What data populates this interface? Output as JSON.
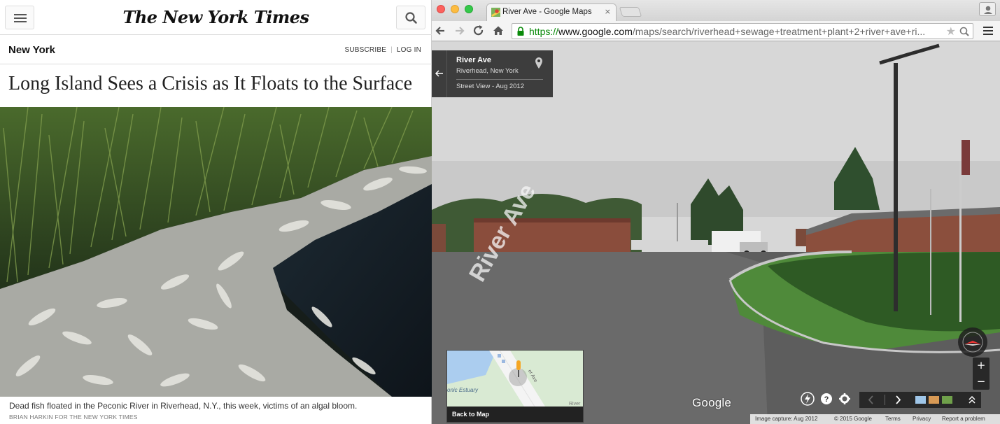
{
  "nyt": {
    "logo": "The New York Times",
    "section": "New York",
    "subscribe": "SUBSCRIBE",
    "login": "LOG IN",
    "headline": "Long Island Sees a Crisis as It Floats to the Surface",
    "caption": "Dead fish floated in the Peconic River in Riverhead, N.Y., this week, victims of an algal bloom.",
    "credit": "BRIAN HARKIN FOR THE NEW YORK TIMES",
    "icons": {
      "menu": "hamburger-icon",
      "search": "search-icon"
    }
  },
  "browser": {
    "tab_title": "River Ave - Google Maps",
    "tab_close": "×",
    "url_scheme": "https://",
    "url_host": "www.google.com",
    "url_path": "/maps/search/riverhead+sewage+treatment+plant+2+river+ave+ri...",
    "icons": {
      "back": "back-arrow-icon",
      "forward": "forward-arrow-icon",
      "reload": "reload-icon",
      "home": "home-icon",
      "lock": "lock-icon",
      "bookmark": "star-icon",
      "menu": "chrome-menu-icon"
    }
  },
  "streetview": {
    "place_title": "River Ave",
    "place_subtitle": "Riverhead, New York",
    "capture_label": "Street View - Aug 2012",
    "road_marking": "River Ave",
    "minimap_label": "onic Estuary",
    "minimap_road": "River",
    "minimap_street": "er Ave",
    "back_to_map": "Back to Map",
    "google_logo": "Google",
    "zoom_in": "+",
    "zoom_out": "−",
    "footer": {
      "capture": "Image capture: Aug 2012",
      "copyright": "© 2015 Google",
      "terms": "Terms",
      "privacy": "Privacy",
      "report": "Report a problem"
    }
  },
  "colors": {
    "nyt_text": "#222222",
    "url_secure": "#0a8a0a",
    "overlay_dark": "#282828",
    "sky": "#d7d7d7",
    "grass": "#4f8a3a"
  }
}
